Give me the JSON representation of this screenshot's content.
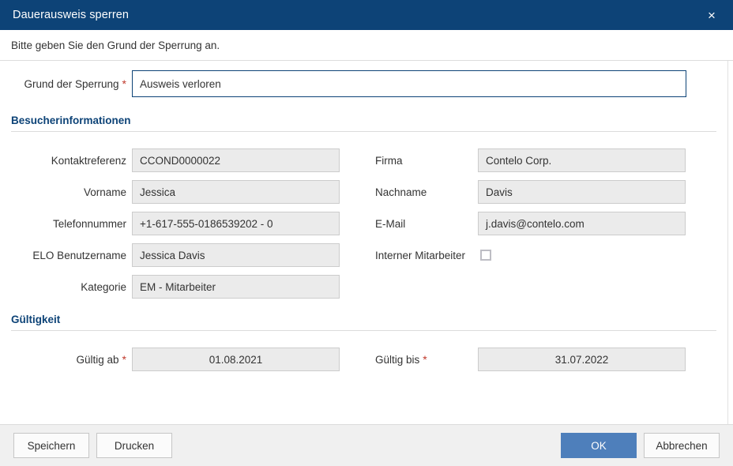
{
  "window": {
    "title": "Dauerausweis sperren",
    "close_icon": "close-icon",
    "close_glyph": "×",
    "accent_color": "#0d4377",
    "primary_button_color": "#4e7fbb",
    "required_marker_color": "#c0392b"
  },
  "instruction": {
    "text": "Bitte geben Sie den Grund der Sperrung an."
  },
  "reason": {
    "label": "Grund der Sperrung",
    "required_marker": "*",
    "value": "Ausweis verloren"
  },
  "sections": {
    "visitor": {
      "title": "Besucherinformationen",
      "fields": [
        {
          "label": "Kontaktreferenz",
          "value": "CCOND0000022"
        },
        {
          "label": "Vorname",
          "value": "Jessica"
        },
        {
          "label": "Telefonnummer",
          "value": "+1-617-555-0186539202 - 0"
        },
        {
          "label": "ELO Benutzername",
          "value": "Jessica Davis"
        },
        {
          "label": "Kategorie",
          "value": "EM - Mitarbeiter"
        },
        {
          "label": "Firma",
          "value": "Contelo Corp."
        },
        {
          "label": "Nachname",
          "value": "Davis"
        },
        {
          "label": "E-Mail",
          "value": "j.davis@contelo.com"
        },
        {
          "label": "Interner Mitarbeiter",
          "value": "",
          "checked": false
        }
      ]
    },
    "validity": {
      "title": "Gültigkeit",
      "from": {
        "label": "Gültig ab",
        "required_marker": "*",
        "value": "01.08.2021"
      },
      "to": {
        "label": "Gültig bis",
        "required_marker": "*",
        "value": "31.07.2022"
      }
    }
  },
  "footer": {
    "save_label": "Speichern",
    "print_label": "Drucken",
    "ok_label": "OK",
    "cancel_label": "Abbrechen"
  }
}
